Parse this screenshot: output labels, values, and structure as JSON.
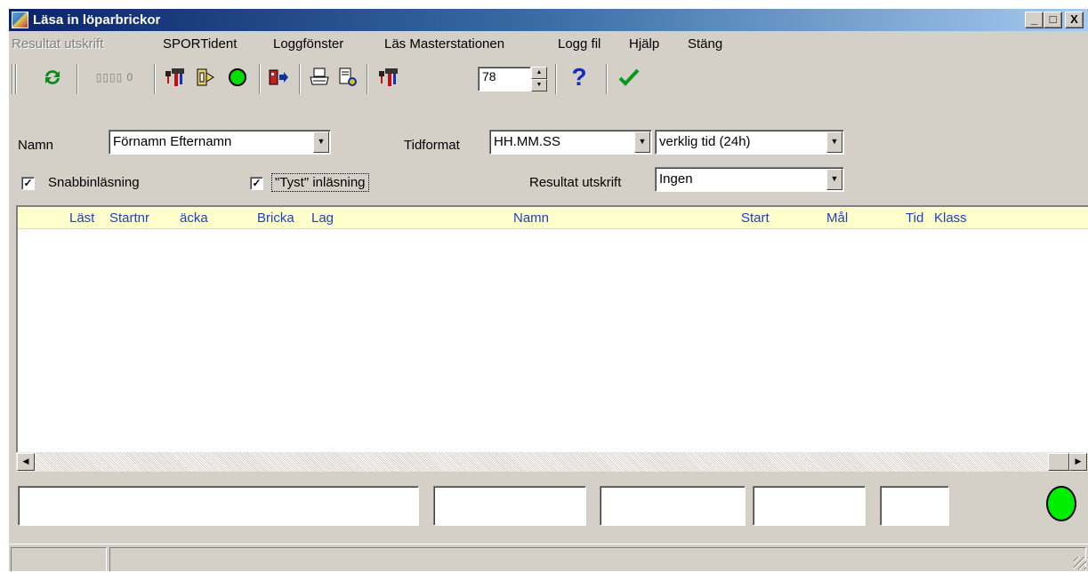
{
  "window": {
    "title": "Läsa in löparbrickor",
    "controls": {
      "minimize": "_",
      "maximize": "□",
      "close": "X"
    }
  },
  "menu": [
    {
      "label": "Resultat utskrift",
      "disabled": true
    },
    {
      "label": "SPORTident"
    },
    {
      "label": "Loggfönster"
    },
    {
      "label": "Läs Masterstationen"
    },
    {
      "label": "Logg fil"
    },
    {
      "label": "Hjälp"
    },
    {
      "label": "Stäng"
    }
  ],
  "toolbar": {
    "counter_label": "0",
    "spin_value": "78",
    "help_glyph": "?",
    "icons": [
      "refresh-icon",
      "counter-icon",
      "station-icon",
      "reader-icon",
      "green-dot-icon",
      "exit-icon",
      "print-icon",
      "print-preview-icon",
      "station-settings-icon",
      "help-icon",
      "ok-check-icon"
    ]
  },
  "form": {
    "name_label": "Namn",
    "name_value": "Förnamn Efternamn",
    "timeformat_label": "Tidformat",
    "timeformat_value": "HH.MM.SS",
    "timemode_value": "verklig tid (24h)",
    "quickread_label": "Snabbinläsning",
    "quickread_checked": true,
    "silent_label": "\"Tyst\" inläsning",
    "silent_checked": true,
    "print_label": "Resultat utskrift",
    "print_value": "Ingen"
  },
  "grid": {
    "columns": [
      "Läst",
      "Startnr",
      "äcka",
      "Bricka",
      "Lag",
      "Namn",
      "Start",
      "Mål",
      "Tid",
      "Klass"
    ],
    "header_color": "#ffffcc",
    "header_text_color": "#2040c0",
    "rows": []
  },
  "bottom_fields": [
    "",
    "",
    "",
    "",
    ""
  ],
  "status": {
    "indicator_color": "#00ee00",
    "panes": [
      "",
      ""
    ]
  }
}
